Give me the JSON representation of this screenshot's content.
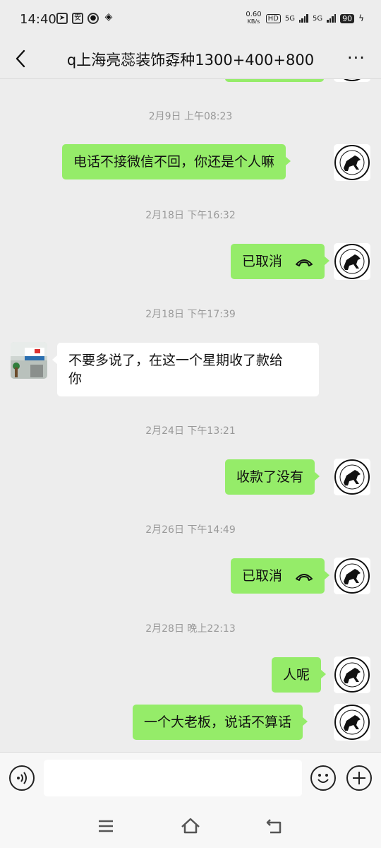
{
  "status_bar": {
    "time": "14:40",
    "net_speed": "0.60",
    "net_unit": "KB/s",
    "hd": "HD",
    "signal1": "5G",
    "signal2": "5G",
    "battery": "90"
  },
  "header": {
    "title": "q上海亮蕊装饰孬种1300+400+800"
  },
  "messages": [
    {
      "timestamp": "2月9日 上午08:23",
      "text": "电话不接微信不回，你还是个人嘛"
    },
    {
      "timestamp": "2月18日 下午16:32",
      "text": "已取消"
    },
    {
      "timestamp": "2月18日 下午17:39",
      "line1": "不要多说了，在这一个星期收了款给",
      "line2": "你"
    },
    {
      "timestamp": "2月24日 下午13:21",
      "text": "收款了没有"
    },
    {
      "timestamp": "2月26日 下午14:49",
      "text": "已取消"
    },
    {
      "timestamp": "2月28日 晚上22:13",
      "text": "人呢"
    },
    {
      "text": "一个大老板，说话不算话"
    }
  ],
  "colors": {
    "outgoing_bubble": "#95ec69",
    "incoming_bubble": "#ffffff",
    "background": "#ededed"
  }
}
